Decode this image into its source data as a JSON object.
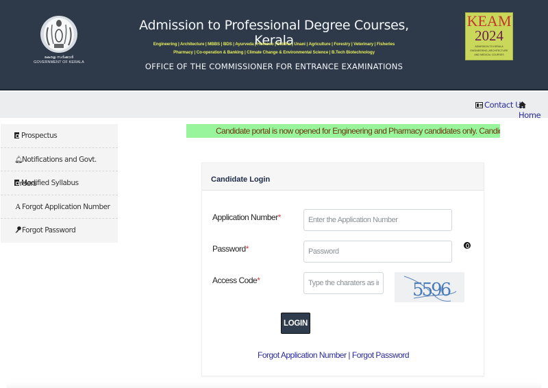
{
  "header": {
    "emblem_text_malayalam": "കേരള സർക്കാർ",
    "emblem_text_english": "GOVERNMENT OF KERALA",
    "title": "Admission to Professional Degree Courses, Kerala",
    "courses_line1": "Engineering | Architecture | MBBS | BDS | Ayurveda | Homoeo | Siddha | Unani | Agriculture | Forestry | Veterinary | Fisheries",
    "courses_line2": "Pharmacy | Co-operation & Banking | Climate Change & Environmental Science | B.Tech Biotechnology",
    "office": "OFFICE OF THE COMMISSIONER FOR ENTRANCE EXAMINATIONS",
    "keam_logo": {
      "name": "KEAM",
      "year": "2024",
      "subtitle": "ADMISSION TO KERALA ENGINEERING, ARCHITECTURE AND MEDICAL COURSES"
    }
  },
  "nav": {
    "contact_icon": "contact-card-icon",
    "contact_label": "Contact Us",
    "home_icon": "home-icon",
    "home_label": "Home"
  },
  "sidebar": {
    "items": [
      {
        "icon": "pdf-file-icon",
        "label": "Prospectus"
      },
      {
        "icon": "bell-icon",
        "label": "Notifications and Govt. Orders"
      },
      {
        "icon": "pdf-file-icon",
        "label": "Modified Syllabus"
      },
      {
        "icon": "font-a-icon",
        "label": "Forgot Application Number"
      },
      {
        "icon": "key-icon",
        "label": "Forgot Password"
      }
    ]
  },
  "notice": {
    "text": "Candidate portal is now opened for Engineering and Pharmacy candidates only. Candidate portal for Medic"
  },
  "login": {
    "heading": "Candidate Login",
    "application_number": {
      "label": "Application Number",
      "required_mark": "*",
      "value": "",
      "placeholder": "Enter the Application Number"
    },
    "password": {
      "label": "Password",
      "required_mark": "*",
      "value": "",
      "placeholder": "Password",
      "toggle_icon": "eye-toggle-icon"
    },
    "access_code": {
      "label": "Access Code",
      "required_mark": "*",
      "value": "",
      "placeholder": "Type the charaters as in the image",
      "captcha_text": "5596"
    },
    "submit_label": "LOGIN",
    "forgot_app_link": "Forgot Application Number",
    "link_separator": "|",
    "forgot_pwd_link": "Forgot Password"
  },
  "colors": {
    "header_bg": "#2e3a4a",
    "courses_text": "#e6ec5c",
    "notice_bg": "#98f59c",
    "notice_text": "#6a3510",
    "link": "#2a2a9a",
    "required": "#d43a3a",
    "button_bg": "#2f3c4d"
  }
}
